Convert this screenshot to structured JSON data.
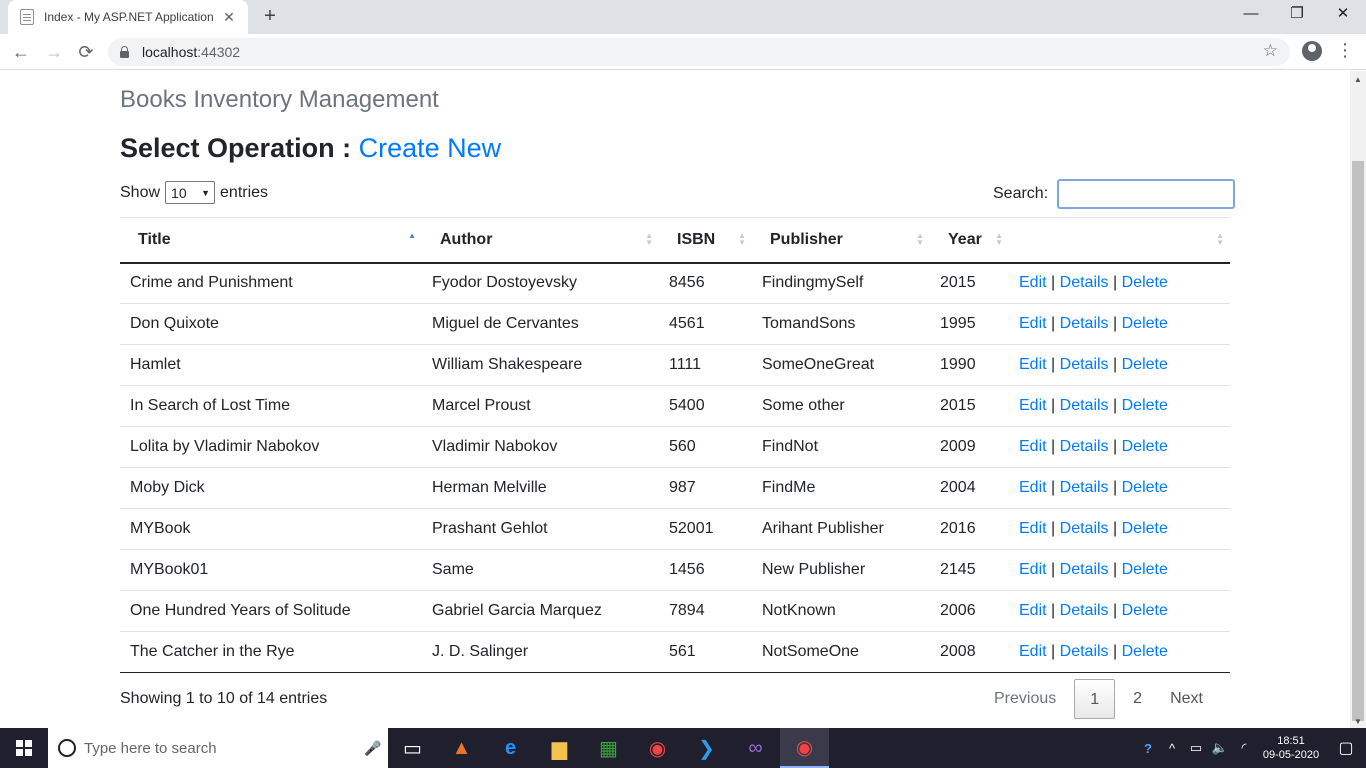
{
  "browser": {
    "tab_title": "Index - My ASP.NET Application",
    "tab_close": "✕",
    "new_tab": "+",
    "url_host": "localhost",
    "url_port": ":44302",
    "minimize": "—",
    "maximize": "❐",
    "close": "✕",
    "back": "←",
    "forward": "→",
    "reload": "⟳",
    "bookmark": "☆",
    "menu": "⋮"
  },
  "page": {
    "app_title": "Books Inventory Management",
    "operation_label": "Select Operation :",
    "create_new": "Create New",
    "show_label": "Show",
    "entries_per_page": "10",
    "entries_label": "entries",
    "search_label": "Search:",
    "search_value": ""
  },
  "table": {
    "headers": [
      "Title",
      "Author",
      "ISBN",
      "Publisher",
      "Year",
      ""
    ],
    "sorted_column": "Title",
    "rows": [
      {
        "title": "Crime and Punishment",
        "author": "Fyodor Dostoyevsky",
        "isbn": "8456",
        "publisher": "FindingmySelf",
        "year": "2015"
      },
      {
        "title": "Don Quixote",
        "author": "Miguel de Cervantes",
        "isbn": "4561",
        "publisher": "TomandSons",
        "year": "1995"
      },
      {
        "title": "Hamlet",
        "author": "William Shakespeare",
        "isbn": "1111",
        "publisher": "SomeOneGreat",
        "year": "1990"
      },
      {
        "title": "In Search of Lost Time",
        "author": "Marcel Proust",
        "isbn": "5400",
        "publisher": "Some other",
        "year": "2015"
      },
      {
        "title": "Lolita by Vladimir Nabokov",
        "author": "Vladimir Nabokov",
        "isbn": "560",
        "publisher": "FindNot",
        "year": "2009"
      },
      {
        "title": "Moby Dick",
        "author": "Herman Melville",
        "isbn": "987",
        "publisher": "FindMe",
        "year": "2004"
      },
      {
        "title": "MYBook",
        "author": "Prashant Gehlot",
        "isbn": "52001",
        "publisher": "Arihant Publisher",
        "year": "2016"
      },
      {
        "title": "MYBook01",
        "author": "Same",
        "isbn": "1456",
        "publisher": "New Publisher",
        "year": "2145"
      },
      {
        "title": "One Hundred Years of Solitude",
        "author": "Gabriel Garcia Marquez",
        "isbn": "7894",
        "publisher": "NotKnown",
        "year": "2006"
      },
      {
        "title": "The Catcher in the Rye",
        "author": "J. D. Salinger",
        "isbn": "561",
        "publisher": "NotSomeOne",
        "year": "2008"
      }
    ],
    "actions": {
      "edit": "Edit",
      "details": "Details",
      "delete": "Delete",
      "separator": "|"
    }
  },
  "footer": {
    "info": "Showing 1 to 10 of 14 entries",
    "previous": "Previous",
    "page_1": "1",
    "page_2": "2",
    "next": "Next"
  },
  "taskbar": {
    "search_placeholder": "Type here to search",
    "time": "18:51",
    "date": "09-05-2020"
  },
  "colors": {
    "link": "#007bff",
    "muted": "#6c757d",
    "text": "#212529",
    "taskbar": "#1f1f2d"
  }
}
